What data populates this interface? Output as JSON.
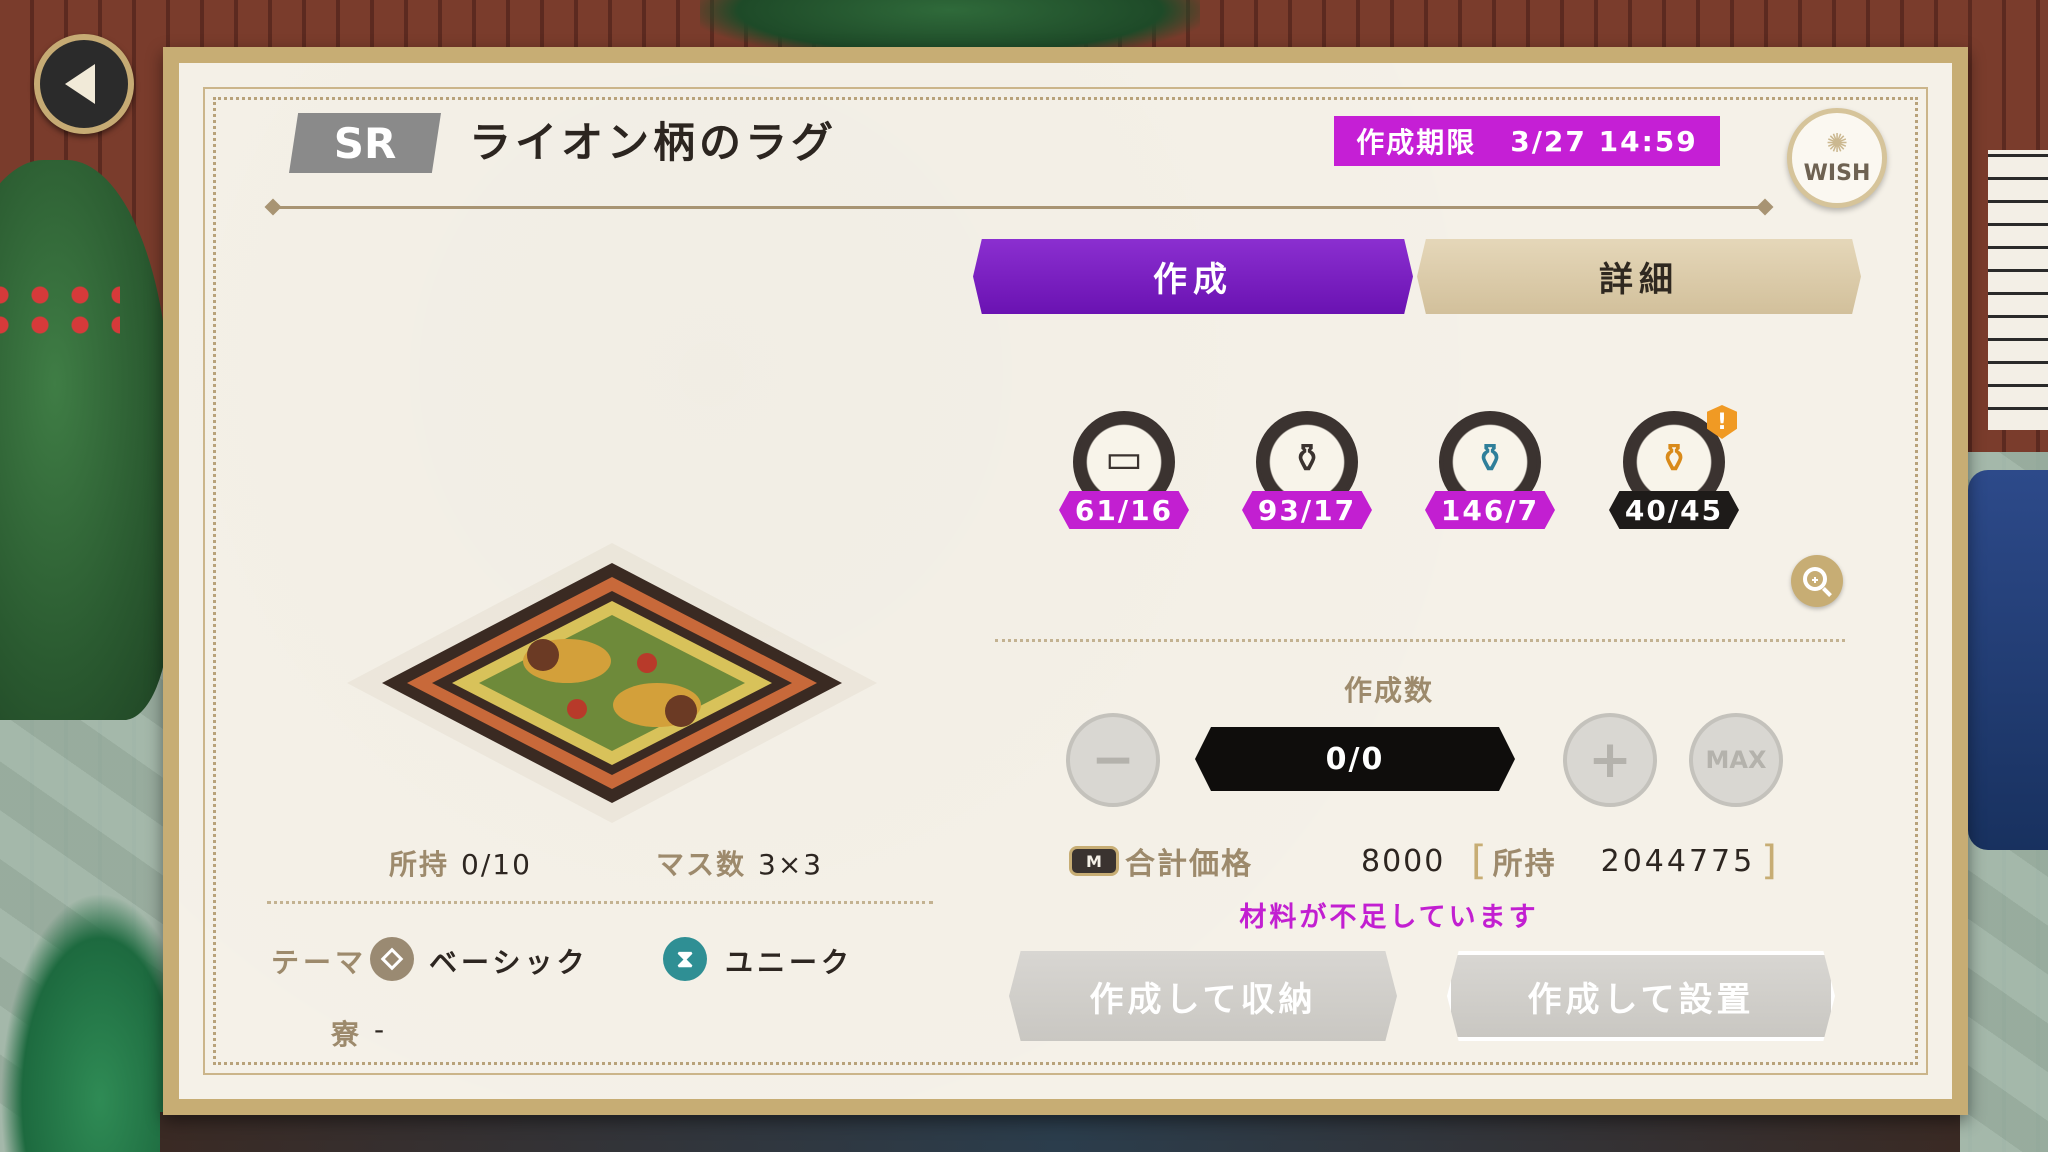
{
  "header": {
    "rarity": "SR",
    "item_name": "ライオン柄のラグ",
    "deadline_label": "作成期限",
    "deadline_value": "3/27 14:59",
    "wish_label": "WISH"
  },
  "tabs": [
    {
      "label": "作成",
      "active": true
    },
    {
      "label": "詳細",
      "active": false
    }
  ],
  "item_info": {
    "owned_label": "所持",
    "owned_value": "0/10",
    "grid_label": "マス数",
    "grid_value": "3×3",
    "theme_label": "テーマ",
    "theme_value": "ベーシック",
    "unique_value": "ユニーク",
    "dorm_label": "寮",
    "dorm_value": "-"
  },
  "materials": [
    {
      "icon": "cloth-roll-icon",
      "count": "61/16",
      "sufficient": true
    },
    {
      "icon": "paint-jar-icon",
      "count": "93/17",
      "sufficient": true
    },
    {
      "icon": "blue-paint-jar-icon",
      "count": "146/7",
      "sufficient": true
    },
    {
      "icon": "orange-paint-jar-icon",
      "count": "40/45",
      "sufficient": false
    }
  ],
  "crafting": {
    "count_label": "作成数",
    "count_value": "0/0",
    "max_label": "MAX",
    "total_price_label": "合計価格",
    "total_price_value": "8000",
    "owned_money_label": "所持",
    "owned_money_value": "2044775",
    "currency_icon_text": "M",
    "warning": "材料が不足しています",
    "store_button": "作成して収納",
    "place_button": "作成して設置"
  },
  "colors": {
    "accent_purple": "#c21fd1",
    "tab_active": "#6a12b2",
    "panel_gold": "#c7ad74"
  }
}
